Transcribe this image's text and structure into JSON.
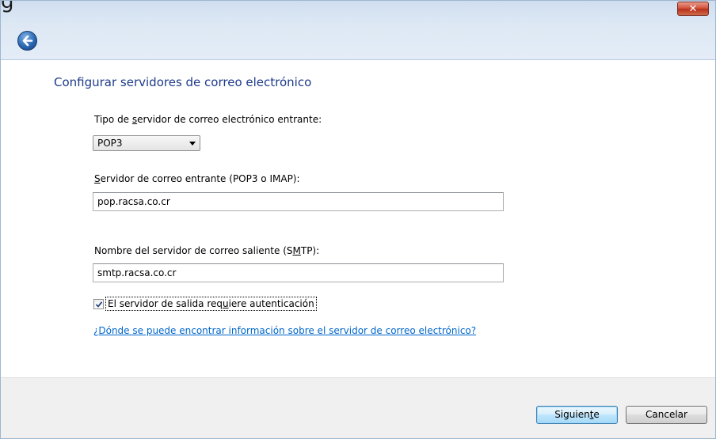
{
  "window": {
    "title_partial": "g",
    "close_label": "✕"
  },
  "page": {
    "title": "Configurar servidores de correo electrónico"
  },
  "form": {
    "server_type": {
      "label_pre": "Tipo de ",
      "label_key": "s",
      "label_post": "ervidor de correo electrónico entrante:",
      "selected": "POP3"
    },
    "incoming": {
      "label_key": "S",
      "label_post": "ervidor de correo entrante (POP3 o IMAP):",
      "value": "pop.racsa.co.cr"
    },
    "outgoing": {
      "label_pre": "Nombre del servidor de correo saliente (S",
      "label_key": "M",
      "label_post": "TP):",
      "value": "smtp.racsa.co.cr"
    },
    "auth": {
      "checked": true,
      "label_pre": "El servidor de salida req",
      "label_key": "u",
      "label_post": "iere autenticación"
    },
    "help_link": "¿Dónde se puede encontrar información sobre el servidor de correo electrónico?"
  },
  "footer": {
    "next_pre": "Siguien",
    "next_key": "t",
    "next_post": "e",
    "cancel_label": "Cancelar"
  },
  "icons": {
    "back": "back-arrow-icon",
    "close": "close-icon",
    "dropdown": "chevron-down-icon",
    "check": "checkmark-icon"
  }
}
